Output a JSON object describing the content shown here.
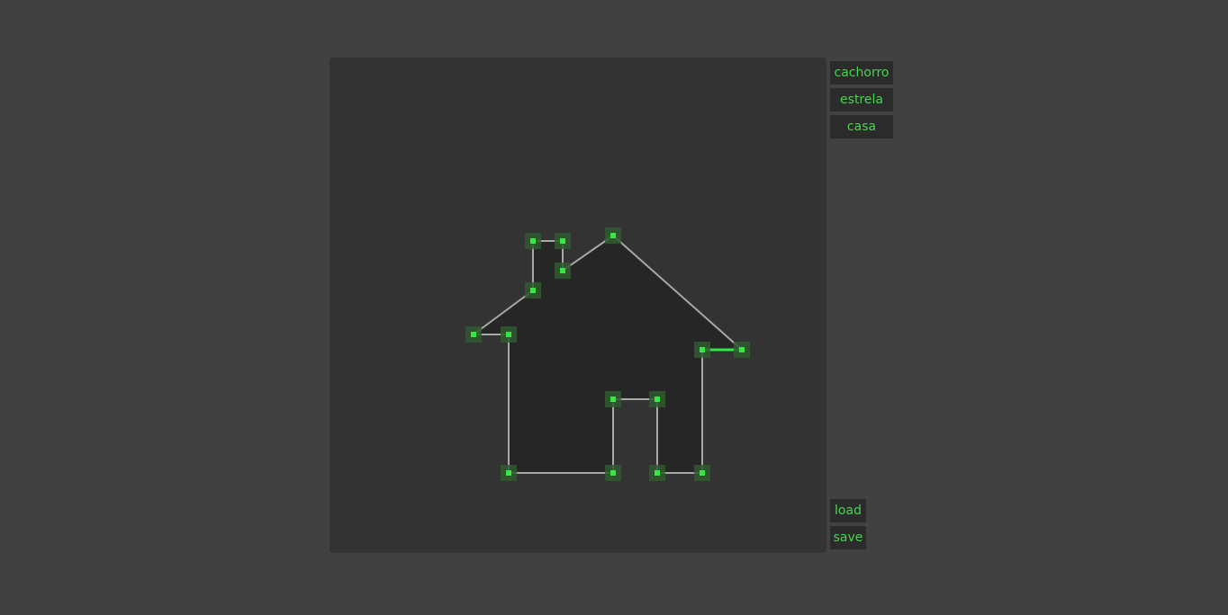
{
  "presets": [
    {
      "label": "cachorro"
    },
    {
      "label": "estrela"
    },
    {
      "label": "casa"
    }
  ],
  "actions": {
    "load_label": "load",
    "save_label": "save"
  },
  "colors": {
    "background": "#414141",
    "canvas": "#333333",
    "shape_fill": "#262626",
    "edge": "#a8a8a8",
    "edge_selected": "#2ee845",
    "vertex": "#36e841",
    "vertex_handle": "#2f5a2f",
    "button_bg": "#2b2b2b",
    "button_text": "#43d649"
  }
}
